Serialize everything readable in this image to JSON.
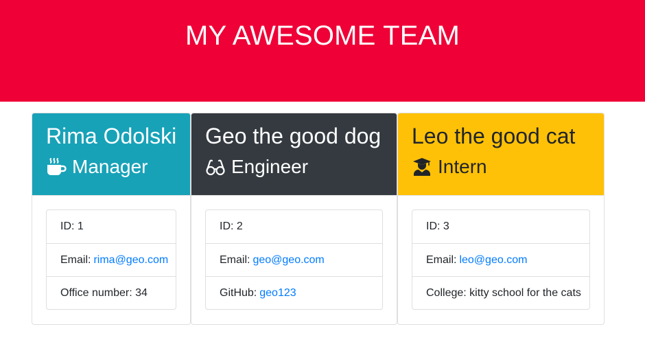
{
  "header": {
    "title": "MY AWESOME TEAM"
  },
  "colors": {
    "header_bg": "#ef0037",
    "manager_bg": "#17a2b8",
    "engineer_bg": "#343a40",
    "intern_bg": "#ffc107",
    "link": "#007bff"
  },
  "cards": [
    {
      "name": "Rima Odolski",
      "role": "Manager",
      "role_icon": "mug-hot-icon",
      "id_label": "ID: 1",
      "email_prefix": "Email:",
      "email": "rima@geo.com",
      "extra_label": "Office number: 34"
    },
    {
      "name": "Geo the good dog",
      "role": "Engineer",
      "role_icon": "glasses-icon",
      "id_label": "ID: 2",
      "email_prefix": "Email:",
      "email": "geo@geo.com",
      "extra_prefix": "GitHub:",
      "extra_link": "geo123"
    },
    {
      "name": "Leo the good cat",
      "role": "Intern",
      "role_icon": "graduate-icon",
      "id_label": "ID: 3",
      "email_prefix": "Email:",
      "email": "leo@geo.com",
      "extra_label": "College: kitty school for the cats"
    }
  ]
}
